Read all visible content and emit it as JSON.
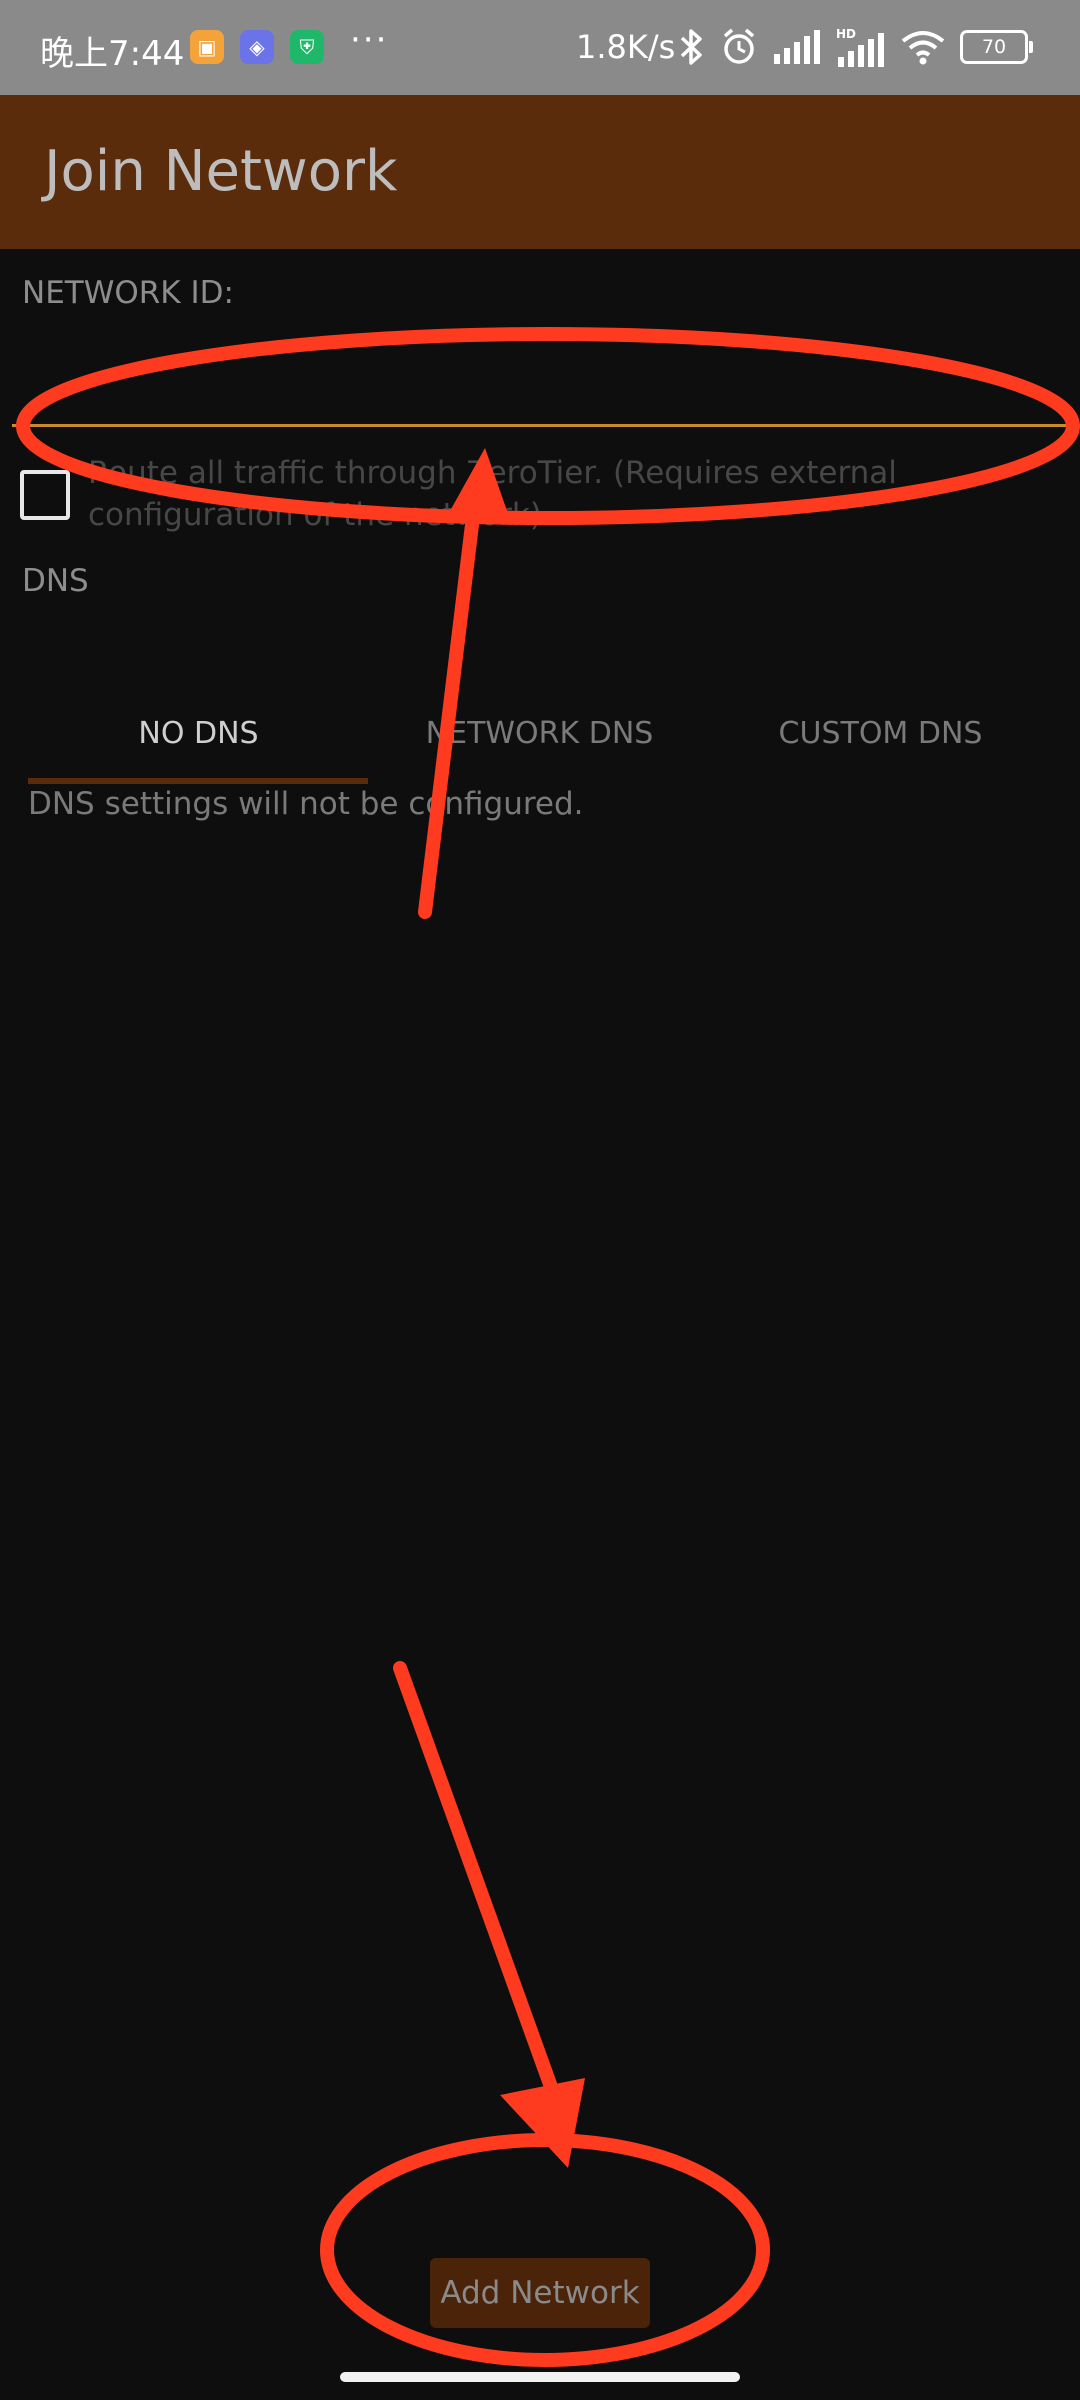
{
  "status_bar": {
    "time": "晚上7:44",
    "more": "···",
    "net_speed": "1.8K/s",
    "signal_label": "HD",
    "battery": "70",
    "icons": [
      "gallery-app-icon",
      "bluetooth-app-icon",
      "shield-app-icon",
      "bluetooth-icon",
      "alarm-icon",
      "signal-icon",
      "signal-hd-icon",
      "wifi-icon",
      "battery-icon"
    ]
  },
  "app_bar": {
    "title": "Join Network"
  },
  "form": {
    "network_id_label": "NETWORK ID:",
    "network_id_value": "",
    "route_label": "Route all traffic through ZeroTier. (Requires external configuration of the network)",
    "route_checked": false,
    "dns_label": "DNS"
  },
  "dns_tabs": {
    "items": [
      {
        "label": "NO DNS",
        "active": true
      },
      {
        "label": "NETWORK DNS",
        "active": false
      },
      {
        "label": "CUSTOM DNS",
        "active": false
      }
    ],
    "description": "DNS settings will not be configured."
  },
  "actions": {
    "add_network_label": "Add Network"
  },
  "colors": {
    "app_bar": "#5a2c0c",
    "accent_underline": "#c98a2a",
    "annotation_red": "#ff3b1f",
    "background": "#0e0e0e"
  }
}
